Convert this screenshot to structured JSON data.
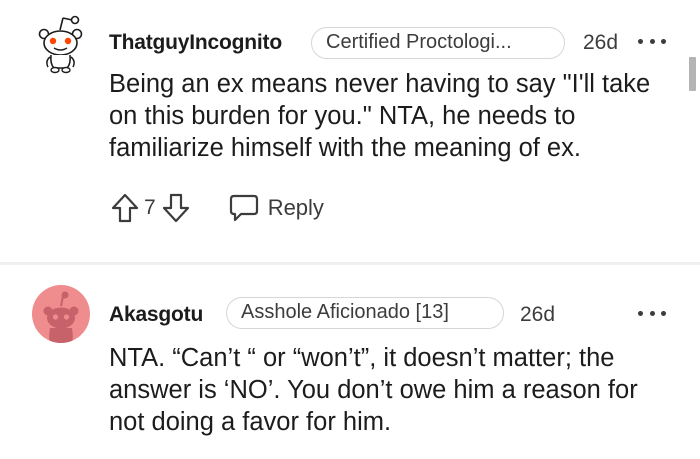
{
  "comments": [
    {
      "username": "ThatguyIncognito",
      "flair": "Certified Proctologi...",
      "age": "26d",
      "avatar_icon": "snoo-default-icon",
      "body": "Being an ex means never having to say \"I'll take on this burden for you.\" NTA, he needs to familiarize himself with the meaning of ex.",
      "score": "7",
      "reply_label": "Reply"
    },
    {
      "username": "Akasgotu",
      "flair": "Asshole Aficionado [13]",
      "age": "26d",
      "avatar_icon": "snoo-pink-avatar-icon",
      "body": "NTA. “Can’t “ or “won’t”, it doesn’t matter; the answer is ‘NO’. You don’t owe him a reason for not doing a favor for him."
    }
  ],
  "colors": {
    "text": "#1c1c1c",
    "muted": "#3c3c3c",
    "flair_border": "#d6d6d6",
    "avatar_pink": "#ee8c8e",
    "divider": "#edeff1"
  },
  "icons": {
    "upvote": "arrow-up-icon",
    "downvote": "arrow-down-icon",
    "reply": "speech-bubble-icon",
    "more": "ellipsis-icon"
  }
}
